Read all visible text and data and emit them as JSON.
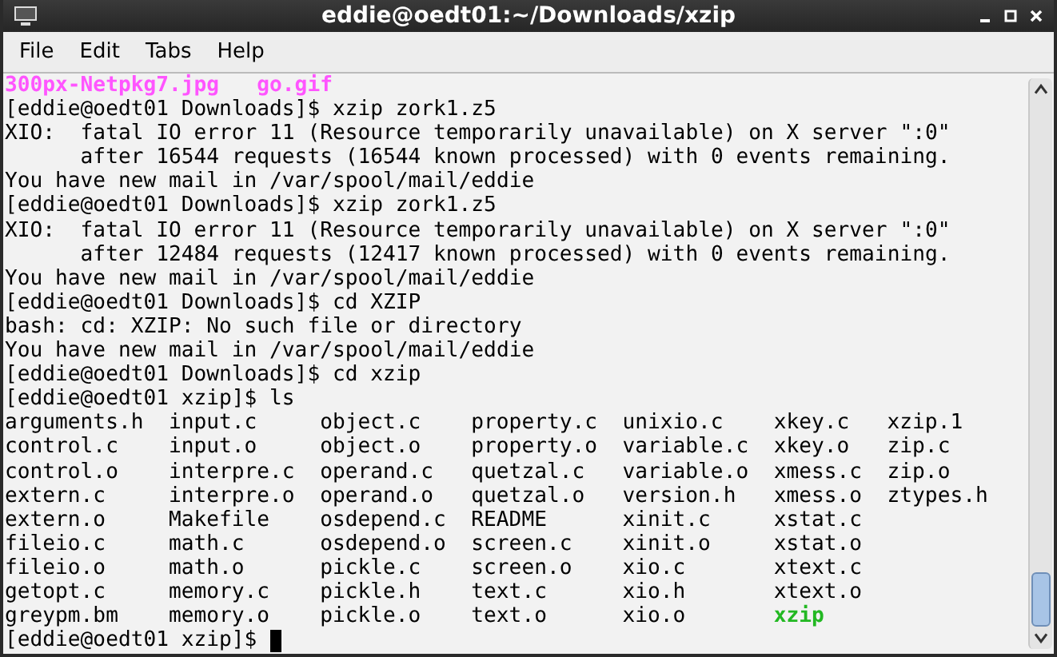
{
  "window": {
    "title": "eddie@oedt01:~/Downloads/xzip"
  },
  "menu": [
    "File",
    "Edit",
    "Tabs",
    "Help"
  ],
  "terminal": {
    "lines": [
      {
        "kind": "files",
        "files": [
          {
            "name": "300px-Netpkg7.jpg",
            "color": "#ff55ff"
          },
          {
            "name": "go.gif",
            "color": "#ff55ff"
          }
        ]
      },
      {
        "kind": "text",
        "text": "[eddie@oedt01 Downloads]$ xzip zork1.z5"
      },
      {
        "kind": "text",
        "text": "XIO:  fatal IO error 11 (Resource temporarily unavailable) on X server \":0\""
      },
      {
        "kind": "text",
        "text": "      after 16544 requests (16544 known processed) with 0 events remaining."
      },
      {
        "kind": "text",
        "text": "You have new mail in /var/spool/mail/eddie"
      },
      {
        "kind": "text",
        "text": "[eddie@oedt01 Downloads]$ xzip zork1.z5"
      },
      {
        "kind": "text",
        "text": "XIO:  fatal IO error 11 (Resource temporarily unavailable) on X server \":0\""
      },
      {
        "kind": "text",
        "text": "      after 12484 requests (12417 known processed) with 0 events remaining."
      },
      {
        "kind": "text",
        "text": "You have new mail in /var/spool/mail/eddie"
      },
      {
        "kind": "text",
        "text": "[eddie@oedt01 Downloads]$ cd XZIP"
      },
      {
        "kind": "text",
        "text": "bash: cd: XZIP: No such file or directory"
      },
      {
        "kind": "text",
        "text": "You have new mail in /var/spool/mail/eddie"
      },
      {
        "kind": "text",
        "text": "[eddie@oedt01 Downloads]$ cd xzip"
      },
      {
        "kind": "text",
        "text": "[eddie@oedt01 xzip]$ ls"
      },
      {
        "kind": "listing",
        "rows": [
          [
            {
              "name": "arguments.h",
              "color": "#000000"
            },
            {
              "name": "input.c",
              "color": "#000000"
            },
            {
              "name": "object.c",
              "color": "#000000"
            },
            {
              "name": "property.c",
              "color": "#000000"
            },
            {
              "name": "unixio.c",
              "color": "#000000"
            },
            {
              "name": "xkey.c",
              "color": "#000000"
            },
            {
              "name": "xzip.1",
              "color": "#000000"
            }
          ],
          [
            {
              "name": "control.c",
              "color": "#000000"
            },
            {
              "name": "input.o",
              "color": "#000000"
            },
            {
              "name": "object.o",
              "color": "#000000"
            },
            {
              "name": "property.o",
              "color": "#000000"
            },
            {
              "name": "variable.c",
              "color": "#000000"
            },
            {
              "name": "xkey.o",
              "color": "#000000"
            },
            {
              "name": "zip.c",
              "color": "#000000"
            }
          ],
          [
            {
              "name": "control.o",
              "color": "#000000"
            },
            {
              "name": "interpre.c",
              "color": "#000000"
            },
            {
              "name": "operand.c",
              "color": "#000000"
            },
            {
              "name": "quetzal.c",
              "color": "#000000"
            },
            {
              "name": "variable.o",
              "color": "#000000"
            },
            {
              "name": "xmess.c",
              "color": "#000000"
            },
            {
              "name": "zip.o",
              "color": "#000000"
            }
          ],
          [
            {
              "name": "extern.c",
              "color": "#000000"
            },
            {
              "name": "interpre.o",
              "color": "#000000"
            },
            {
              "name": "operand.o",
              "color": "#000000"
            },
            {
              "name": "quetzal.o",
              "color": "#000000"
            },
            {
              "name": "version.h",
              "color": "#000000"
            },
            {
              "name": "xmess.o",
              "color": "#000000"
            },
            {
              "name": "ztypes.h",
              "color": "#000000"
            }
          ],
          [
            {
              "name": "extern.o",
              "color": "#000000"
            },
            {
              "name": "Makefile",
              "color": "#000000"
            },
            {
              "name": "osdepend.c",
              "color": "#000000"
            },
            {
              "name": "README",
              "color": "#000000"
            },
            {
              "name": "xinit.c",
              "color": "#000000"
            },
            {
              "name": "xstat.c",
              "color": "#000000"
            }
          ],
          [
            {
              "name": "fileio.c",
              "color": "#000000"
            },
            {
              "name": "math.c",
              "color": "#000000"
            },
            {
              "name": "osdepend.o",
              "color": "#000000"
            },
            {
              "name": "screen.c",
              "color": "#000000"
            },
            {
              "name": "xinit.o",
              "color": "#000000"
            },
            {
              "name": "xstat.o",
              "color": "#000000"
            }
          ],
          [
            {
              "name": "fileio.o",
              "color": "#000000"
            },
            {
              "name": "math.o",
              "color": "#000000"
            },
            {
              "name": "pickle.c",
              "color": "#000000"
            },
            {
              "name": "screen.o",
              "color": "#000000"
            },
            {
              "name": "xio.c",
              "color": "#000000"
            },
            {
              "name": "xtext.c",
              "color": "#000000"
            }
          ],
          [
            {
              "name": "getopt.c",
              "color": "#000000"
            },
            {
              "name": "memory.c",
              "color": "#000000"
            },
            {
              "name": "pickle.h",
              "color": "#000000"
            },
            {
              "name": "text.c",
              "color": "#000000"
            },
            {
              "name": "xio.h",
              "color": "#000000"
            },
            {
              "name": "xtext.o",
              "color": "#000000"
            }
          ],
          [
            {
              "name": "greypm.bm",
              "color": "#000000"
            },
            {
              "name": "memory.o",
              "color": "#000000"
            },
            {
              "name": "pickle.o",
              "color": "#000000"
            },
            {
              "name": "text.o",
              "color": "#000000"
            },
            {
              "name": "xio.o",
              "color": "#000000"
            },
            {
              "name": "xzip",
              "color": "#22b822"
            }
          ]
        ]
      },
      {
        "kind": "prompt",
        "text": "[eddie@oedt01 xzip]$ ",
        "cursor": true
      }
    ]
  }
}
